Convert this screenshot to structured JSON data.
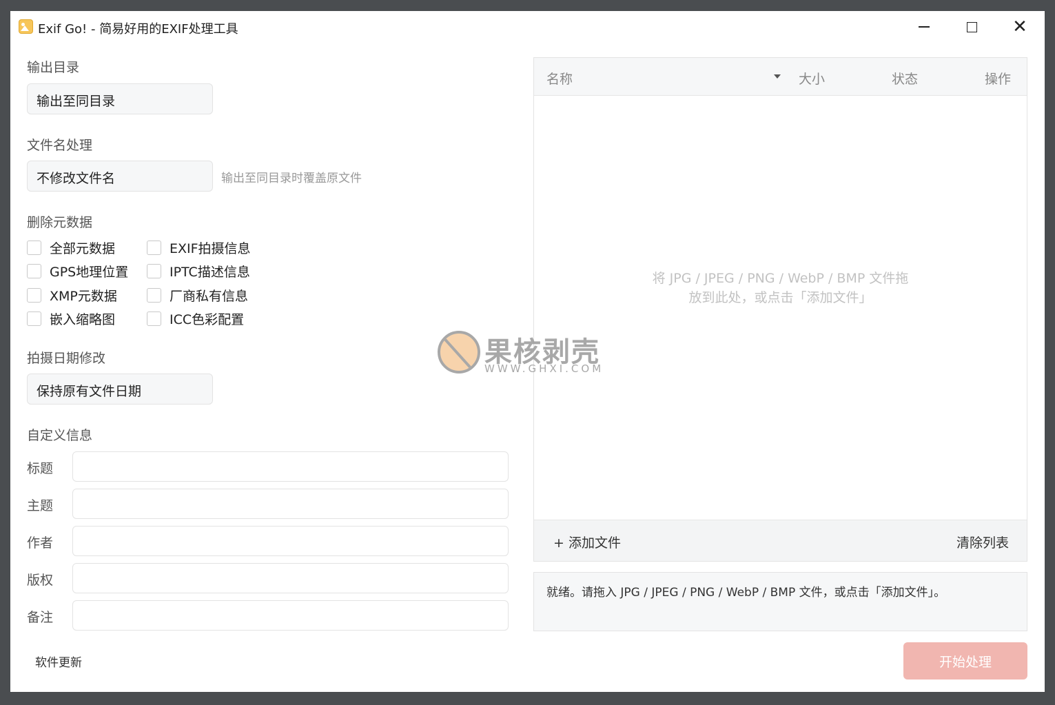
{
  "window": {
    "title": "Exif Go! - 简易好用的EXIF处理工具",
    "icon": "image-icon",
    "controls": {
      "minimize": "minimize-icon",
      "maximize": "maximize-icon",
      "close": "close-icon"
    }
  },
  "output": {
    "label": "输出目录",
    "value": "输出至同目录"
  },
  "filename": {
    "label": "文件名处理",
    "value": "不修改文件名",
    "hint": "输出至同目录时覆盖原文件"
  },
  "metadata": {
    "label": "删除元数据",
    "options": [
      {
        "label": "全部元数据",
        "checked": false
      },
      {
        "label": "EXIF拍摄信息",
        "checked": false
      },
      {
        "label": "GPS地理位置",
        "checked": false
      },
      {
        "label": "IPTC描述信息",
        "checked": false
      },
      {
        "label": "XMP元数据",
        "checked": false
      },
      {
        "label": "厂商私有信息",
        "checked": false
      },
      {
        "label": "嵌入缩略图",
        "checked": false
      },
      {
        "label": "ICC色彩配置",
        "checked": false
      }
    ]
  },
  "date": {
    "label": "拍摄日期修改",
    "value": "保持原有文件日期"
  },
  "custom": {
    "label": "自定义信息",
    "fields": [
      {
        "label": "标题",
        "value": ""
      },
      {
        "label": "主题",
        "value": ""
      },
      {
        "label": "作者",
        "value": ""
      },
      {
        "label": "版权",
        "value": ""
      },
      {
        "label": "备注",
        "value": ""
      }
    ]
  },
  "update": {
    "label": "软件更新"
  },
  "filelist": {
    "columns": {
      "name": "名称",
      "size": "大小",
      "status": "状态",
      "action": "操作"
    },
    "drop_hint_line1": "将 JPG / JPEG / PNG / WebP / BMP 文件拖",
    "drop_hint_line2": "放到此处，或点击「添加文件」",
    "add_label": "+ 添加文件",
    "clear_label": "清除列表"
  },
  "status": {
    "text": "就绪。请拖入 JPG / JPEG / PNG / WebP / BMP 文件，或点击「添加文件」。"
  },
  "start": {
    "label": "开始处理"
  },
  "watermark": {
    "text": "果核剥壳",
    "url": "WWW.GHXI.COM"
  },
  "colors": {
    "start_button": "#f1b6b0",
    "panel_bg": "#f6f7f8",
    "border": "#e3e3e3"
  }
}
